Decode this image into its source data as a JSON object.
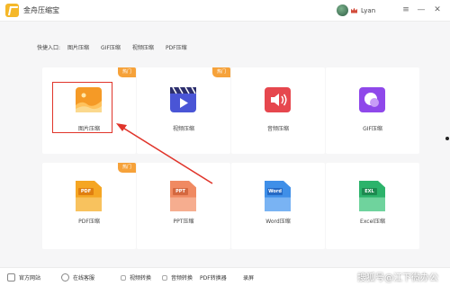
{
  "app": {
    "title": "金舟压缩宝",
    "brand_color": "#f5b82a"
  },
  "user": {
    "name": "Lyan"
  },
  "window_buttons": {
    "menu": "≡",
    "minimize": "—",
    "close": "✕"
  },
  "quick_entry": {
    "label": "快捷入口:",
    "items": [
      "图片压缩",
      "GIF压缩",
      "视频压缩",
      "PDF压缩"
    ]
  },
  "hot_badge": "热门",
  "cards": [
    {
      "label": "图片压缩",
      "icon": "image-icon",
      "color": "#f59a26",
      "hot": true
    },
    {
      "label": "视频压缩",
      "icon": "video-icon",
      "color": "#4a55d6",
      "hot": true
    },
    {
      "label": "音频压缩",
      "icon": "audio-icon",
      "color": "#e6474e",
      "hot": false
    },
    {
      "label": "GIF压缩",
      "icon": "gif-icon",
      "color": "#8f48ea",
      "hot": false
    },
    {
      "label": "PDF压缩",
      "icon": "pdf-file-icon",
      "tag": "PDF",
      "color": "#f5a623",
      "hot": true
    },
    {
      "label": "PPT压缩",
      "icon": "ppt-file-icon",
      "tag": "PPT",
      "color": "#f08a62",
      "hot": false
    },
    {
      "label": "Word压缩",
      "icon": "word-file-icon",
      "tag": "Word",
      "color": "#3f8fe8",
      "hot": false
    },
    {
      "label": "Excel压缩",
      "icon": "excel-file-icon",
      "tag": "EXL",
      "color": "#2cb36b",
      "hot": false
    }
  ],
  "bottom_bar": {
    "items": [
      "官方网站",
      "在线客服",
      "视频转换",
      "音频转换",
      "PDF转换器",
      "录屏"
    ]
  },
  "watermark": "搜狐号@江下微办公",
  "annotation_color": "#e0342a"
}
